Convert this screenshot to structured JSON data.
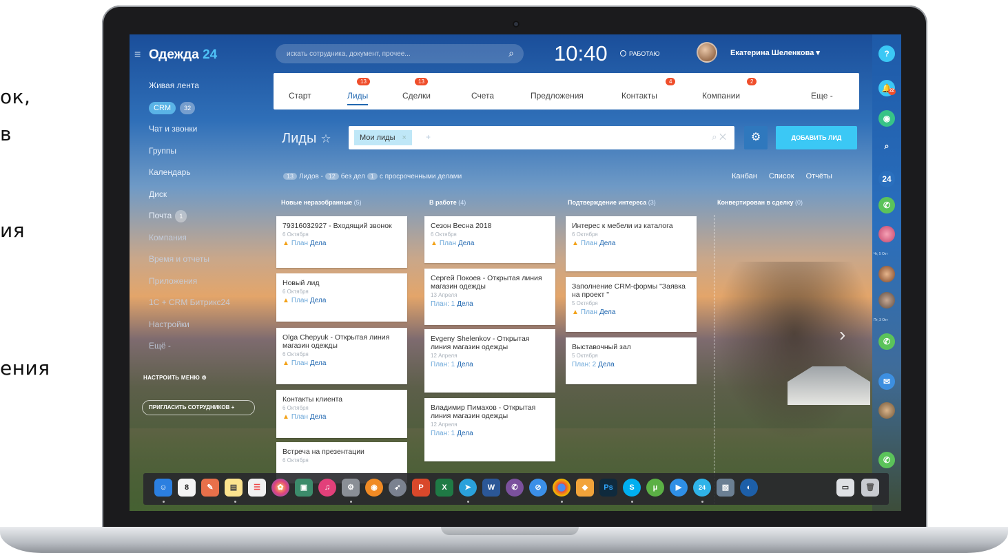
{
  "side_text": [
    "ок,",
    "в",
    "ия",
    "ения"
  ],
  "app": {
    "name": "Одежда",
    "number": "24"
  },
  "sidebar": {
    "items": [
      {
        "label": "Живая лента"
      },
      {
        "label": "CRM",
        "count": "32"
      },
      {
        "label": "Чат и звонки"
      },
      {
        "label": "Группы"
      },
      {
        "label": "Календарь"
      },
      {
        "label": "Диск"
      },
      {
        "label": "Почта",
        "count": "1"
      },
      {
        "label": "Компания"
      },
      {
        "label": "Время и отчеты"
      },
      {
        "label": "Приложения"
      },
      {
        "label": "1С + CRM Битрикс24"
      },
      {
        "label": "Настройки"
      },
      {
        "label": "Ещё -"
      }
    ],
    "configure_menu": "НАСТРОИТЬ МЕНЮ",
    "invite_button": "ПРИГЛАСИТЬ СОТРУДНИКОВ +"
  },
  "header": {
    "search_placeholder": "искать сотрудника, документ, прочее...",
    "clock": "10:40",
    "status": "РАБОТАЮ",
    "user_name": "Екатерина Шеленкова"
  },
  "tabs": [
    {
      "label": "Старт"
    },
    {
      "label": "Лиды",
      "badge": "13",
      "active": true
    },
    {
      "label": "Сделки",
      "badge": "13"
    },
    {
      "label": "Счета"
    },
    {
      "label": "Предложения"
    },
    {
      "label": "Контакты",
      "badge": "4"
    },
    {
      "label": "Компании",
      "badge": "2"
    },
    {
      "label": "Еще -"
    }
  ],
  "leads": {
    "title": "Лиды",
    "filter_tag": "Мои лиды",
    "add_button": "ДОБАВИТЬ ЛИД",
    "counters": {
      "leads_count": "13",
      "leads_label": "Лидов -",
      "no_deals_count": "12",
      "no_deals_label": "без дел",
      "overdue_count": "1",
      "overdue_label": "с просроченными делами"
    },
    "views": [
      "Канбан",
      "Список",
      "Отчёты"
    ]
  },
  "columns": [
    {
      "name": "Новые неразобранные",
      "count": "(5)",
      "color": "#3e9be0",
      "cards": [
        {
          "title": "79316032927 - Входящий звонок",
          "date": "6 Октября",
          "plan": "План",
          "deals": "Дела",
          "warn": true
        },
        {
          "title": "Новый лид",
          "date": "6 Октября",
          "plan": "План",
          "deals": "Дела",
          "warn": true
        },
        {
          "title": "Olga Chepyuk - Открытая линия магазин одежды",
          "date": "6 Октября",
          "plan": "План",
          "deals": "Дела",
          "warn": true
        },
        {
          "title": "Контакты клиента",
          "date": "6 Октября",
          "plan": "План",
          "deals": "Дела",
          "warn": true
        },
        {
          "title": "Встреча на презентации",
          "date": "6 Октября",
          "plan": "",
          "deals": "",
          "warn": false
        }
      ]
    },
    {
      "name": "В работе",
      "count": "(4)",
      "color": "#3e9be0",
      "cards": [
        {
          "title": "Сезон Весна 2018",
          "date": "6 Октября",
          "plan": "План",
          "deals": "Дела",
          "warn": true
        },
        {
          "title": "Сергей Покоев - Открытая линия магазин одежды",
          "date": "13 Апреля",
          "plan": "План: 1",
          "deals": "Дела",
          "warn": false
        },
        {
          "title": "Evgeny Shelenkov - Открытая линия магазин одежды",
          "date": "12 Апреля",
          "plan": "План: 1",
          "deals": "Дела",
          "warn": false
        },
        {
          "title": "Владимир Пимахов - Открытая линия магазин одежды",
          "date": "12 Апреля",
          "plan": "План: 1",
          "deals": "Дела",
          "warn": false
        }
      ]
    },
    {
      "name": "Подтверждение интереса",
      "count": "(3)",
      "color": "#3e9be0",
      "cards": [
        {
          "title": "Интерес к мебели из каталога",
          "date": "6 Октября",
          "plan": "План",
          "deals": "Дела",
          "warn": true
        },
        {
          "title": "Заполнение CRM-формы \"Заявка на проект \"",
          "date": "5 Октября",
          "plan": "План",
          "deals": "Дела",
          "warn": true
        },
        {
          "title": "Выставочный зал",
          "date": "5 Октября",
          "plan": "План: 2",
          "deals": "Дела",
          "warn": false
        }
      ]
    },
    {
      "name": "Конвертирован в сделку",
      "count": "(0)",
      "color": "#8fbf3a",
      "cards": []
    }
  ],
  "rail": {
    "help": "?",
    "notifications_badge": "22",
    "logo": "24",
    "date_label_1": "Чт, 5 Окт",
    "date_label_2": "Пт, 3 Окт"
  },
  "dock": {
    "calendar_day": "8",
    "photoshop": "Ps",
    "skype": "S",
    "bitrix": "24"
  },
  "colors": {
    "accent": "#2067b0",
    "add_button": "#3bc8f5",
    "badge": "#ef4e2b",
    "column": "#3e9be0",
    "column_success": "#8fbf3a"
  }
}
